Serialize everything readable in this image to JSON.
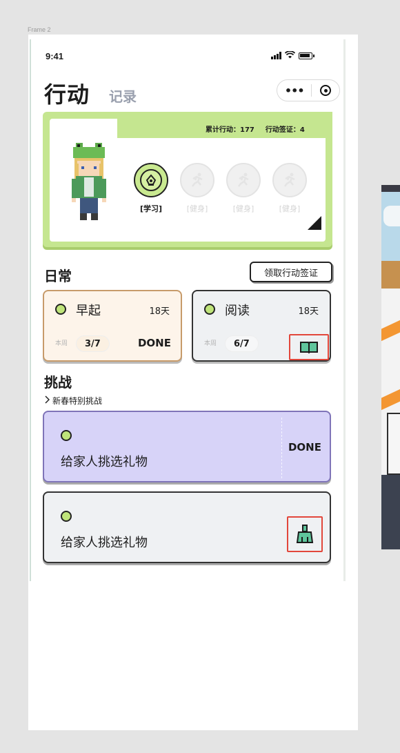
{
  "frame_label": "Frame 2",
  "status_bar": {
    "time": "9:41",
    "signal_icon": "signal-icon",
    "wifi_icon": "wifi-icon",
    "battery_icon": "battery-icon"
  },
  "header": {
    "title": "行动",
    "subtitle": "记录",
    "more_icon": "more-icon",
    "target_icon": "target-icon"
  },
  "hero": {
    "stats_total": "累计行动：177",
    "stats_sign": "行动签证：4",
    "badges": [
      {
        "label": "[学习]",
        "icon": "study-icon",
        "active": true
      },
      {
        "label": "[健身]",
        "icon": "run-icon",
        "active": false
      },
      {
        "label": "[健身]",
        "icon": "run-icon",
        "active": false
      },
      {
        "label": "[健身]",
        "icon": "run-icon",
        "active": false
      }
    ]
  },
  "daily": {
    "title": "日常",
    "claim_button": "领取行动签证",
    "habits": [
      {
        "name": "早起",
        "days": "18天",
        "week_label": "本周",
        "count": "3/7",
        "status": "DONE"
      },
      {
        "name": "阅读",
        "days": "18天",
        "week_label": "本周",
        "count": "6/7",
        "action_icon": "book-icon"
      }
    ]
  },
  "challenges": {
    "title": "挑战",
    "subtitle": "新春特别挑战",
    "items": [
      {
        "name": "给家人挑选礼物",
        "status": "DONE"
      },
      {
        "name": "给家人挑选礼物",
        "action_icon": "broom-icon"
      }
    ]
  },
  "colors": {
    "accent_green": "#c5e690",
    "challenge_purple": "#d7d3f8",
    "highlight_red": "#e2463a"
  }
}
